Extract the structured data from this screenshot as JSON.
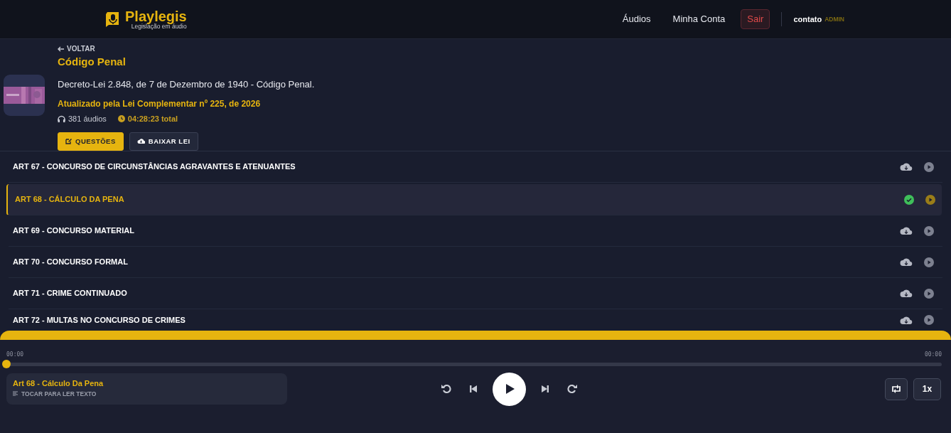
{
  "header": {
    "logo_title": "Playlegis",
    "logo_subtitle": "Legislação em áudio",
    "nav": [
      {
        "label": "Áudios",
        "kind": "link"
      },
      {
        "label": "Minha Conta",
        "kind": "link"
      },
      {
        "label": "Sair",
        "kind": "danger"
      }
    ],
    "user": {
      "name": "contato",
      "role": "ADMIN"
    }
  },
  "law": {
    "back": "VOLTAR",
    "title": "Código Penal",
    "description": "Decreto-Lei 2.848, de 7 de Dezembro de 1940 - Código Penal.",
    "updated": "Atualizado pela Lei Complementar nº 225, de 2026",
    "audio_count": "381 áudios",
    "total_time": "04:28:23 total",
    "buttons": [
      {
        "label": "QUESTÕES",
        "kind": "primary"
      },
      {
        "label": "BAIXAR LEI",
        "kind": "secondary"
      }
    ]
  },
  "articles": [
    {
      "title": "ART 67 - CONCURSO DE CIRCUNSTÂNCIAS AGRAVANTES E ATENUANTES",
      "selected": false,
      "downloaded": false
    },
    {
      "title": "ART 68 - CÁLCULO DA PENA",
      "selected": true,
      "downloaded": true
    },
    {
      "title": "ART 69 - CONCURSO MATERIAL",
      "selected": false,
      "downloaded": false
    },
    {
      "title": "ART 70 - CONCURSO FORMAL",
      "selected": false,
      "downloaded": false
    },
    {
      "title": "ART 71 - CRIME CONTINUADO",
      "selected": false,
      "downloaded": false
    },
    {
      "title": "ART 72 - MULTAS NO CONCURSO DE CRIMES",
      "selected": false,
      "downloaded": false
    }
  ],
  "player": {
    "current_time": "00:00",
    "duration": "00:00",
    "level": 0,
    "track_title": "Art 68 - Cálculo Da Pena",
    "track_hint": "TOCAR PARA LER TEXTO",
    "repeat": false,
    "speed": "1x"
  }
}
